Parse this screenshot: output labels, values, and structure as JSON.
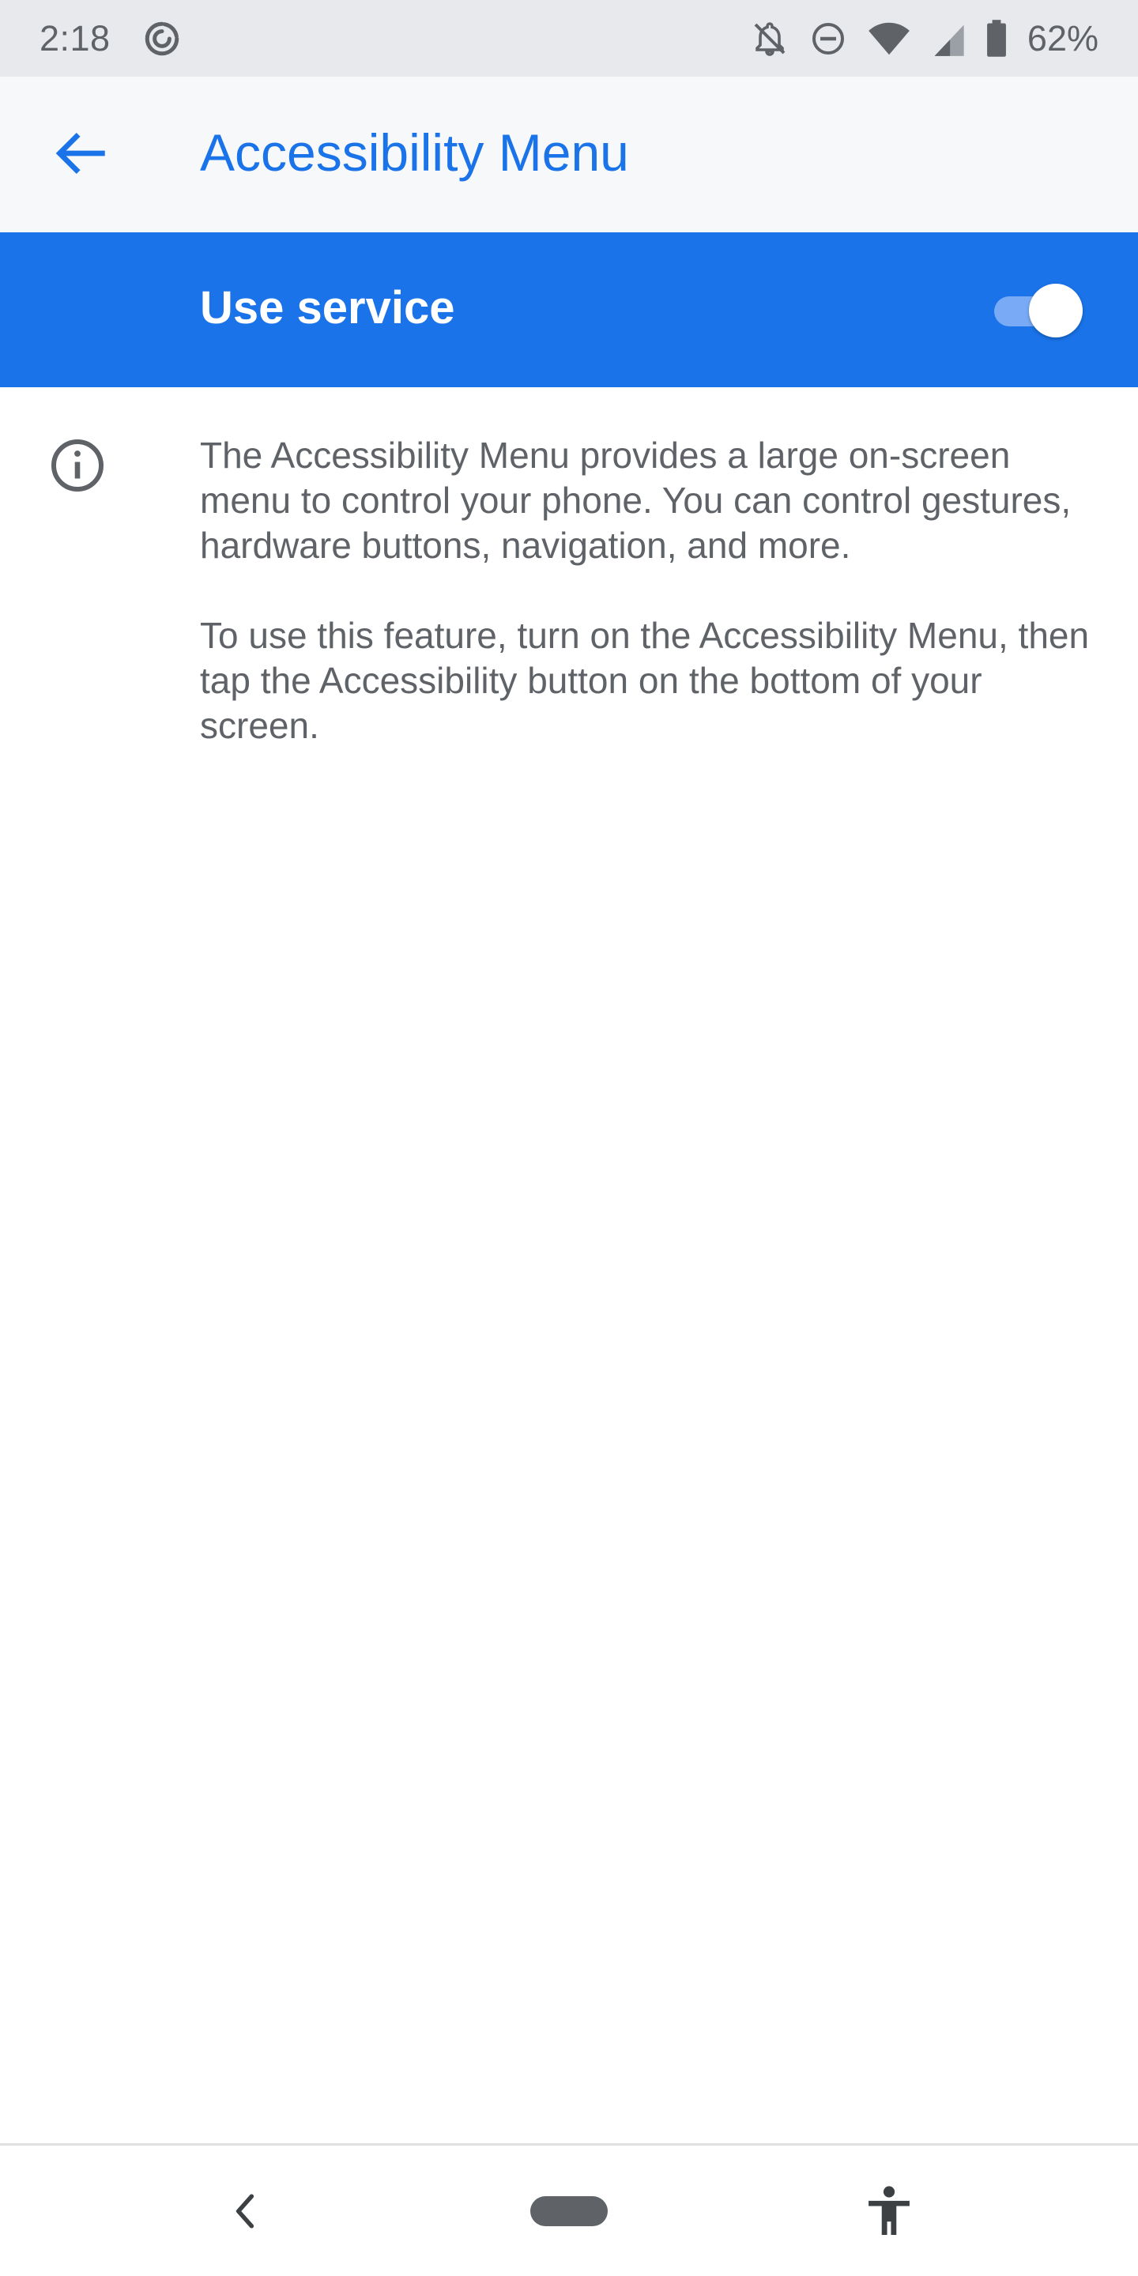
{
  "status_bar": {
    "time": "2:18",
    "left_icon": "data-saver-icon",
    "icons": [
      "notifications-off-icon",
      "do-not-disturb-icon",
      "wifi-icon",
      "cell-signal-icon",
      "battery-icon"
    ],
    "battery_percent": "62%"
  },
  "app_bar": {
    "back_icon": "arrow-back-icon",
    "title": "Accessibility Menu"
  },
  "service": {
    "label": "Use service",
    "enabled": true
  },
  "info": {
    "icon": "info-icon",
    "paragraphs": [
      "The Accessibility Menu provides a large on-screen menu to control your phone. You can control gestures, hardware buttons, navigation, and more.",
      "To use this feature, turn on the Accessibility Menu, then tap the Accessibility button on the bottom of your screen."
    ]
  },
  "nav_bar": {
    "back_icon": "nav-back-icon",
    "home_icon": "nav-home-pill",
    "accessibility_icon": "accessibility-icon"
  },
  "colors": {
    "accent": "#1a73e8",
    "status_bar_bg": "#e8e9ec",
    "app_bar_bg": "#f7f8f9",
    "text_secondary": "#5f6368"
  }
}
